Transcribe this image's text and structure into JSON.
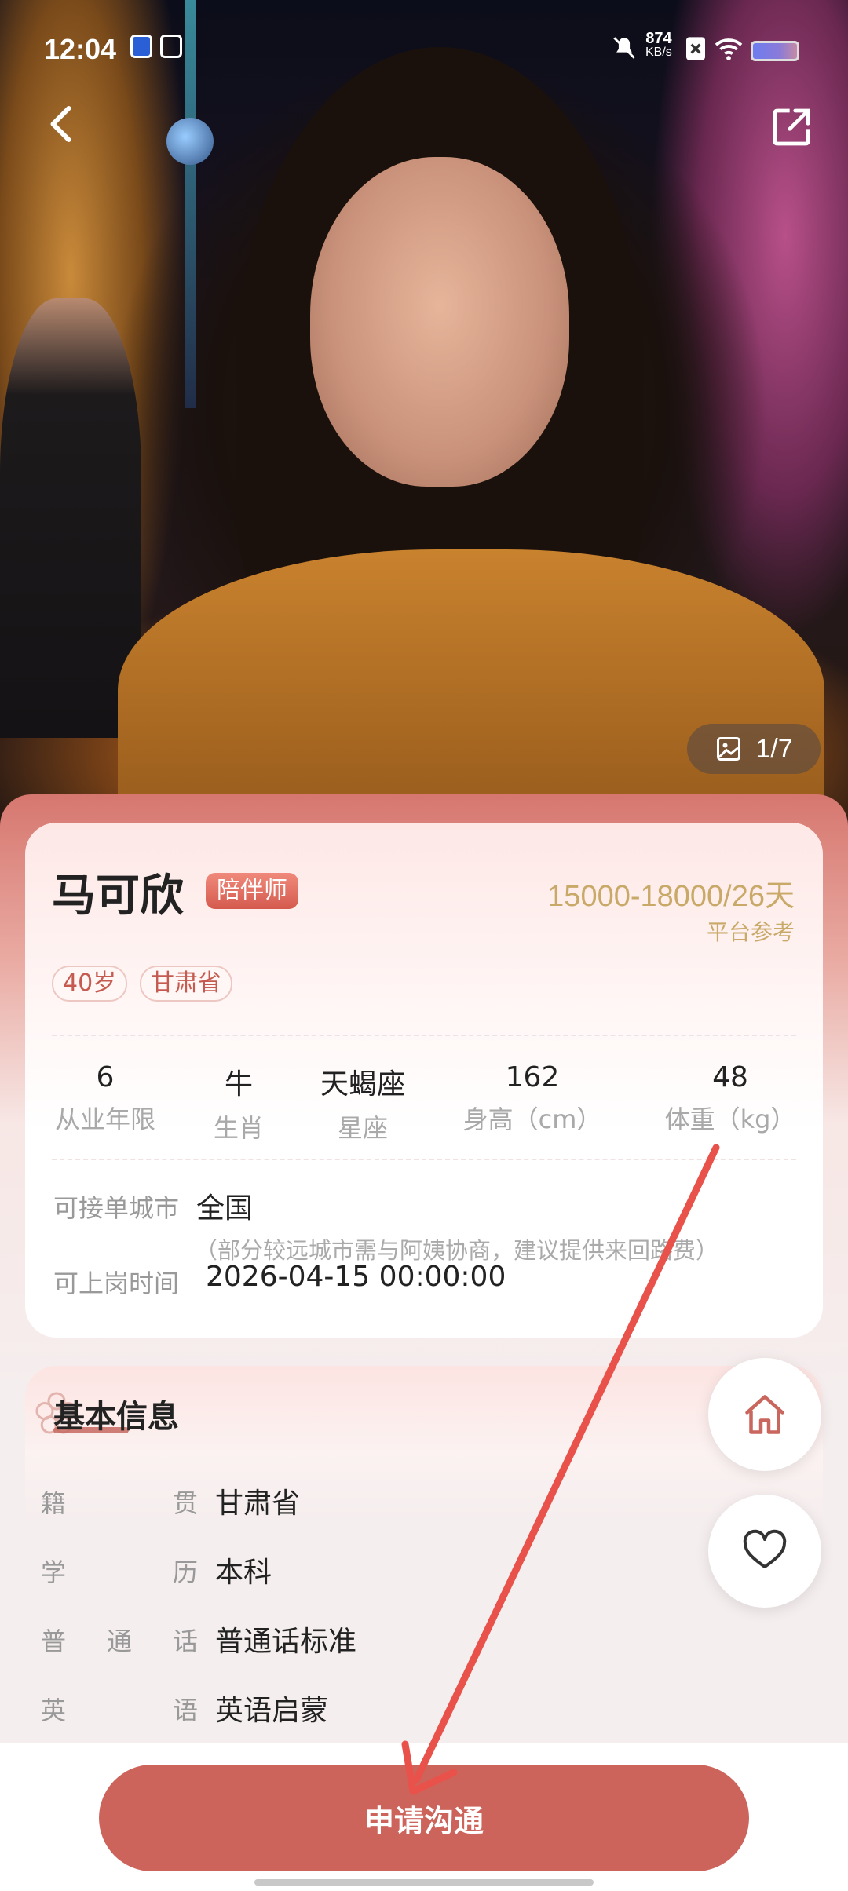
{
  "status_bar": {
    "time": "12:04",
    "net_speed_value": "874",
    "net_speed_unit": "KB/s"
  },
  "photo": {
    "counter": "1/7"
  },
  "profile": {
    "name": "马可欣",
    "role_badge": "陪伴师",
    "salary": "15000-18000/26天",
    "salary_note": "平台参考",
    "tags": [
      "40岁",
      "甘肃省"
    ],
    "stats": [
      {
        "value": "6",
        "label": "从业年限"
      },
      {
        "value": "牛",
        "label": "生肖"
      },
      {
        "value": "天蝎座",
        "label": "星座"
      },
      {
        "value": "162",
        "label": "身高（cm）"
      },
      {
        "value": "48",
        "label": "体重（kg）"
      }
    ],
    "city_label": "可接单城市",
    "city_value": "全国",
    "city_note": "（部分较远城市需与阿姨协商，建议提供来回路费）",
    "start_label": "可上岗时间",
    "start_value": "2026-04-15 00:00:00"
  },
  "basic_info": {
    "title": "基本信息",
    "rows": [
      {
        "label_chars": [
          "籍",
          "贯"
        ],
        "value": "甘肃省"
      },
      {
        "label_chars": [
          "学",
          "历"
        ],
        "value": "本科"
      },
      {
        "label_chars": [
          "普",
          "通",
          "话"
        ],
        "value": "普通话标准"
      },
      {
        "label_chars": [
          "英",
          "语"
        ],
        "value": "英语启蒙"
      }
    ]
  },
  "actions": {
    "cta_label": "申请沟通",
    "home_icon": "home-icon",
    "favorite_icon": "heart-icon",
    "back_icon": "chevron-left-icon",
    "share_icon": "share-icon"
  },
  "colors": {
    "accent": "#cd645b",
    "gold": "#c9a968",
    "annotation_arrow": "#e8524a"
  }
}
